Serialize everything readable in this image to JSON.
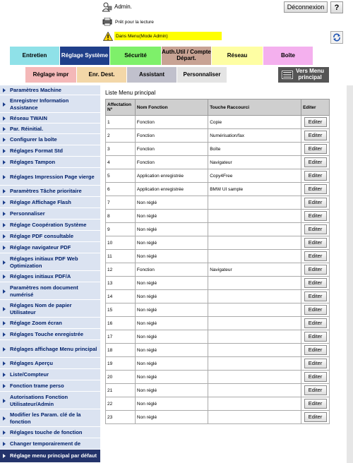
{
  "header": {
    "user_label": "Admin.",
    "logout_label": "Déconnexion",
    "help_label": "?",
    "status_text": "Prêt pour la lecture",
    "mode_text": "Dans Menu(Mode Admin)"
  },
  "top_tabs": [
    {
      "label": "Entretien",
      "color": "#8fe1e8",
      "active": false
    },
    {
      "label": "Réglage Système",
      "color": "#1f3f8a",
      "active": true
    },
    {
      "label": "Sécurité",
      "color": "#7ef06a",
      "active": false
    },
    {
      "label": "Auth.Util / Compte Départ.",
      "color": "#c8a394",
      "active": false
    },
    {
      "label": "Réseau",
      "color": "#fefea3",
      "active": false
    },
    {
      "label": "Boîte",
      "color": "#f4b0ee",
      "active": false
    }
  ],
  "sub_tabs": [
    {
      "label": "Réglage impr",
      "color": "#f4b8b8"
    },
    {
      "label": "Enr. Dest.",
      "color": "#f3d7a8"
    },
    {
      "label": "Assistant",
      "color": "#c0c0cc"
    },
    {
      "label": "Personnaliser",
      "color": "#e4e4e4"
    }
  ],
  "vers_menu_label": "Vers Menu principal",
  "sidebar": {
    "items": [
      {
        "label": "Paramètres Machine"
      },
      {
        "label": "Enregistrer Information Assistance"
      },
      {
        "label": "Réseau TWAIN"
      },
      {
        "label": "Par. Réinitial."
      },
      {
        "label": "Configurer la boîte"
      },
      {
        "label": "Réglages Format Std"
      },
      {
        "label": "Réglages Tampon"
      },
      {
        "label": "Réglages Impression Page vierge"
      },
      {
        "label": "Paramètres Tâche prioritaire"
      },
      {
        "label": "Réglage Affichage Flash"
      },
      {
        "label": "Personnaliser"
      },
      {
        "label": "Réglage Coopération Système"
      },
      {
        "label": "Réglage PDF consultable"
      },
      {
        "label": "Réglage navigateur PDF"
      },
      {
        "label": "Réglages initiaux PDF Web Optimization"
      },
      {
        "label": "Réglages initiaux PDF/A"
      },
      {
        "label": "Paramètres nom document numérisé"
      },
      {
        "label": "Réglages Nom de papier Utilisateur"
      },
      {
        "label": "Réglage Zoom écran"
      },
      {
        "label": "Réglages Touche enregistrée"
      },
      {
        "label": "Réglages affichage Menu principal"
      },
      {
        "label": "Réglages Aperçu"
      },
      {
        "label": "Liste/Compteur"
      },
      {
        "label": "Fonction trame perso"
      },
      {
        "label": "Autorisations Fonction Utilisateur/Admin"
      },
      {
        "label": "Modifier les Param. clé de la fonction"
      },
      {
        "label": "Réglages touche de fonction"
      },
      {
        "label": "Changer temporairement de"
      },
      {
        "label": "Réglage menu principal par défaut"
      }
    ]
  },
  "main": {
    "title": "Liste Menu principal",
    "columns": [
      "Affectation Nº",
      "Nom Fonction",
      "Touche Raccourci",
      "Editer"
    ],
    "rows": [
      [
        "1",
        "Fonction",
        "Copie",
        "Editer"
      ],
      [
        "2",
        "Fonction",
        "Numérisation/fax",
        "Editer"
      ],
      [
        "3",
        "Fonction",
        "Boîte",
        "Editer"
      ],
      [
        "4",
        "Fonction",
        "Navigateur",
        "Editer"
      ],
      [
        "5",
        "Application enregistrée",
        "Copy4Free",
        "Editer"
      ],
      [
        "6",
        "Application enregistrée",
        "BMW UI sample",
        "Editer"
      ],
      [
        "7",
        "Non réglé",
        "",
        "Editer"
      ],
      [
        "8",
        "Non réglé",
        "",
        "Editer"
      ],
      [
        "9",
        "Non réglé",
        "",
        "Editer"
      ],
      [
        "10",
        "Non réglé",
        "",
        "Editer"
      ],
      [
        "11",
        "Non réglé",
        "",
        "Editer"
      ],
      [
        "12",
        "Fonction",
        "Navigateur",
        "Editer"
      ],
      [
        "13",
        "Non réglé",
        "",
        "Editer"
      ],
      [
        "14",
        "Non réglé",
        "",
        "Editer"
      ],
      [
        "15",
        "Non réglé",
        "",
        "Editer"
      ],
      [
        "16",
        "Non réglé",
        "",
        "Editer"
      ],
      [
        "17",
        "Non réglé",
        "",
        "Editer"
      ],
      [
        "18",
        "Non réglé",
        "",
        "Editer"
      ],
      [
        "19",
        "Non réglé",
        "",
        "Editer"
      ],
      [
        "20",
        "Non réglé",
        "",
        "Editer"
      ],
      [
        "21",
        "Non réglé",
        "",
        "Editer"
      ],
      [
        "22",
        "Non réglé",
        "",
        "Editer"
      ],
      [
        "23",
        "Non réglé",
        "",
        "Editer"
      ]
    ]
  }
}
